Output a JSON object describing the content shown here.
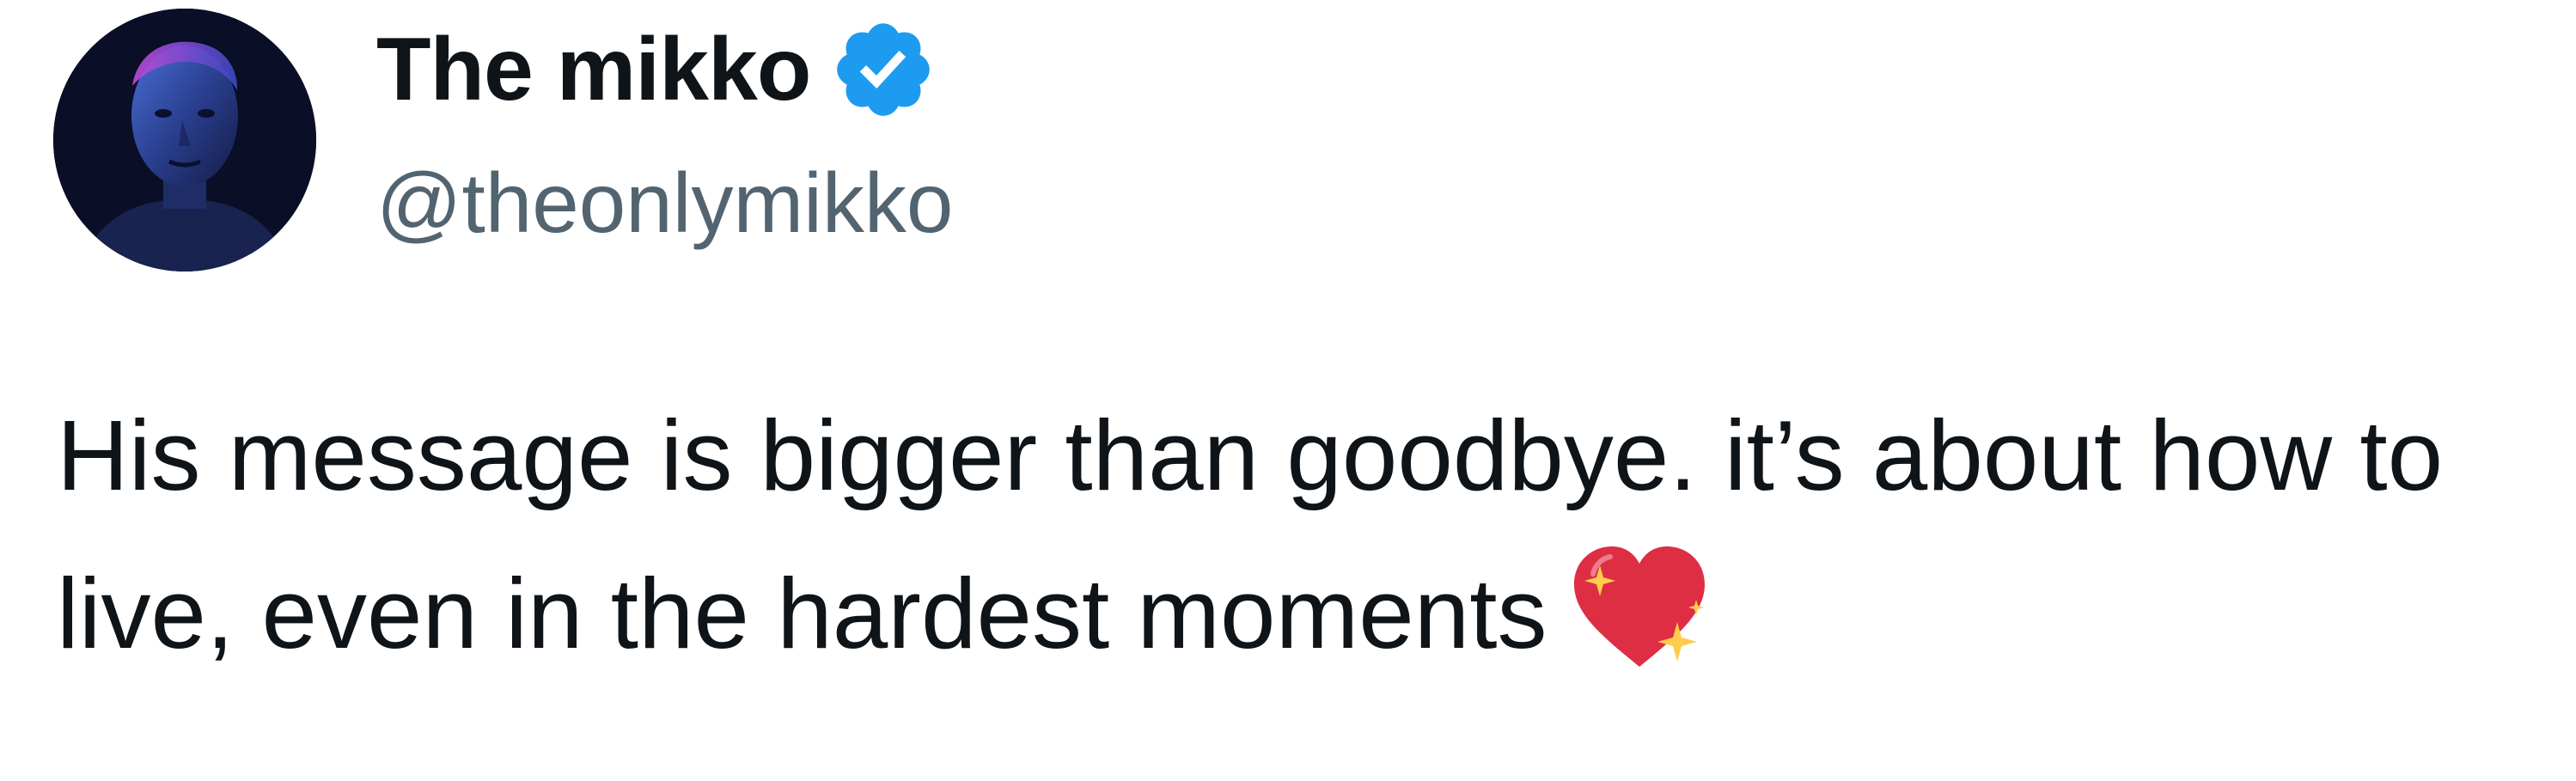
{
  "author": {
    "display_name": "The mikko",
    "handle": "@theonlymikko",
    "verified_color": "#1d9bf0"
  },
  "tweet": {
    "text": "His message is bigger than goodbye. it’s about how to live, even in the hardest moments",
    "emoji": "sparkling-heart"
  },
  "icons": {
    "verified": "verified-badge-icon",
    "emoji": "sparkling-heart-icon"
  }
}
